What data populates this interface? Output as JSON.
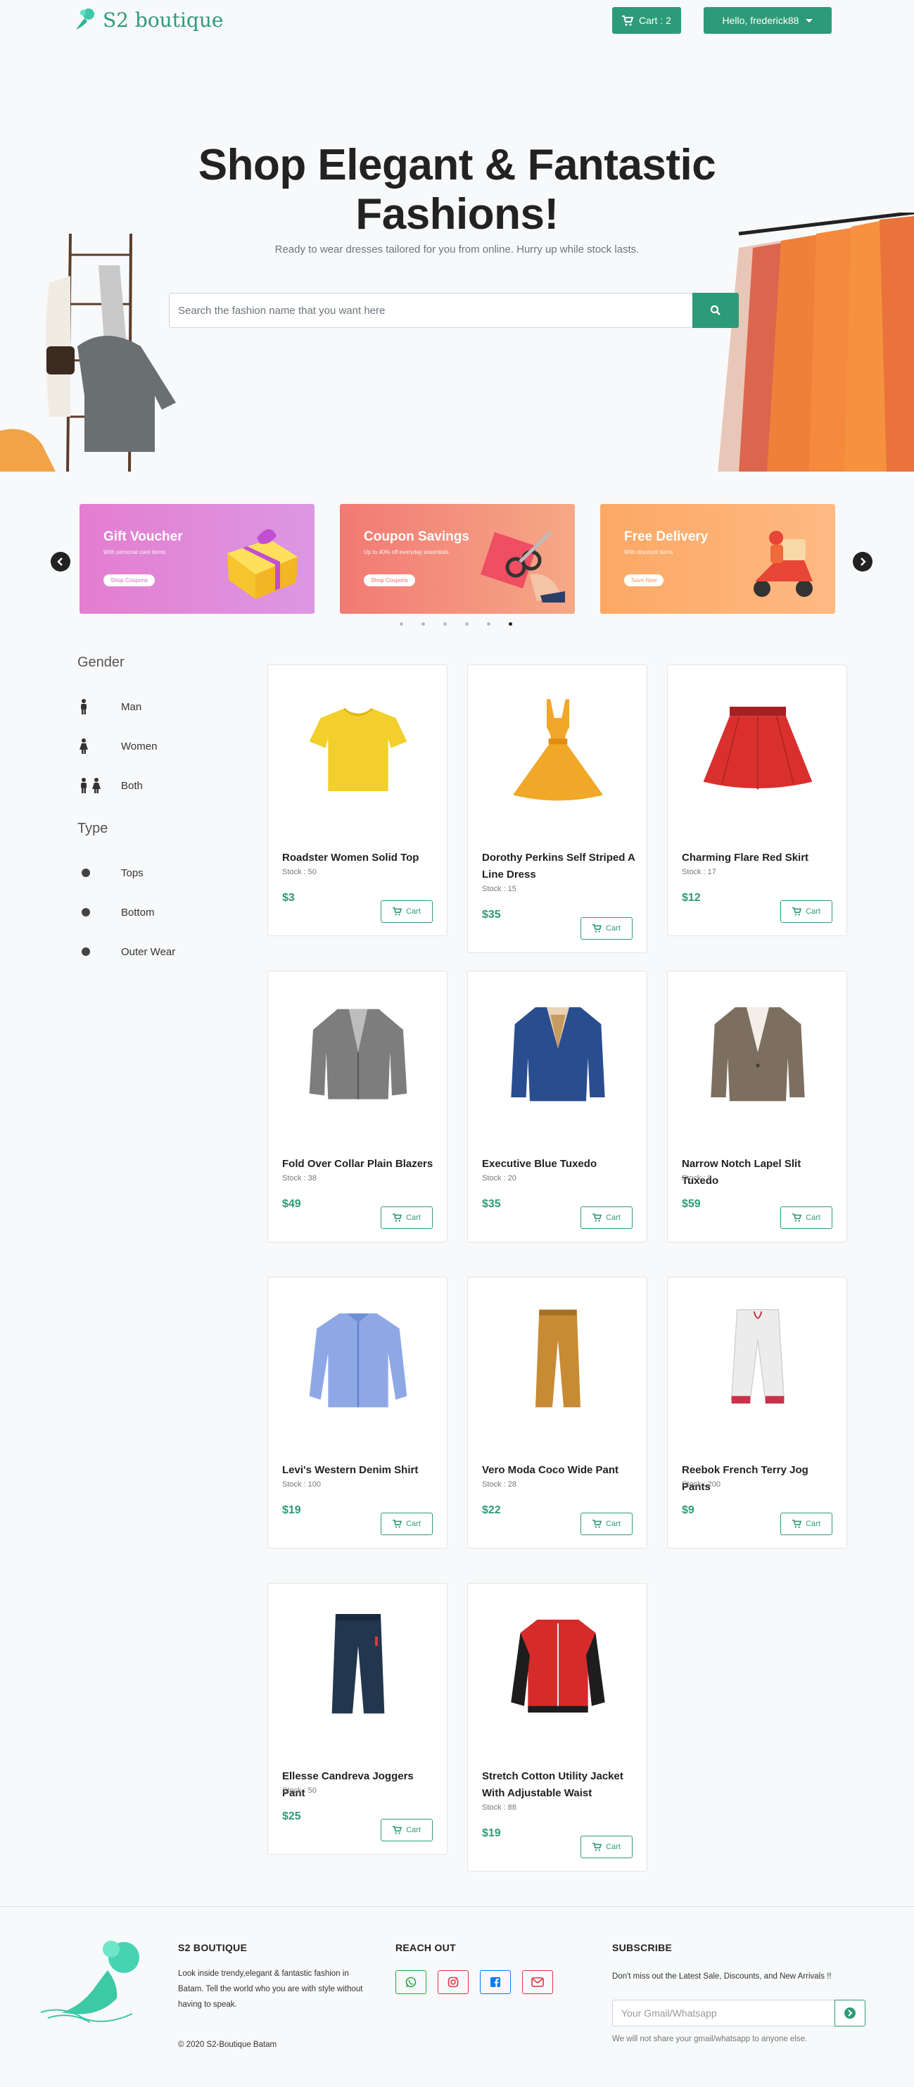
{
  "nav": {
    "brand": "S2 boutique",
    "cart_label": "Cart : 2",
    "user_label": "Hello, frederick88"
  },
  "hero": {
    "title_line1": "Shop Elegant & Fantastic",
    "title_line2": "Fashions!",
    "subtitle": "Ready to wear dresses tailored for you from online. Hurry up while stock lasts.",
    "search_placeholder": "Search the fashion name that you want here"
  },
  "promos": [
    {
      "title": "Gift Voucher",
      "desc": "With personal care items",
      "button": "Shop Coupons",
      "color_from": "#e77dd0",
      "color_to": "#d98ee8"
    },
    {
      "title": "Coupon Savings",
      "desc": "Up to 40% off everyday essentials",
      "button": "Shop Coupons",
      "color_from": "#f37a74",
      "color_to": "#f5a785"
    },
    {
      "title": "Free Delivery",
      "desc": "With discount items",
      "button": "Save Now",
      "color_from": "#fca866",
      "color_to": "#fdb57f"
    }
  ],
  "filters": {
    "gender_heading": "Gender",
    "gender": [
      "Man",
      "Women",
      "Both"
    ],
    "type_heading": "Type",
    "type": [
      "Tops",
      "Bottom",
      "Outer Wear"
    ]
  },
  "cart_button_label": "Cart",
  "products": [
    {
      "name": "Roadster Women Solid Top",
      "stock": "Stock : 50",
      "price": "$3",
      "icon": "yellow-top"
    },
    {
      "name": "Dorothy Perkins Self Striped A Line Dress",
      "stock": "Stock : 15",
      "price": "$35",
      "icon": "yellow-dress"
    },
    {
      "name": "Charming Flare Red Skirt",
      "stock": "Stock : 17",
      "price": "$12",
      "icon": "red-skirt"
    },
    {
      "name": "Fold Over Collar Plain Blazers",
      "stock": "Stock : 38",
      "price": "$49",
      "icon": "grey-blazer"
    },
    {
      "name": "Executive Blue Tuxedo",
      "stock": "Stock : 20",
      "price": "$35",
      "icon": "blue-tuxedo"
    },
    {
      "name": "Narrow Notch Lapel Slit Tuxedo",
      "stock": "Stock : 8",
      "price": "$59",
      "icon": "brown-tuxedo"
    },
    {
      "name": "Levi's Western Denim Shirt",
      "stock": "Stock : 100",
      "price": "$19",
      "icon": "denim-shirt"
    },
    {
      "name": "Vero Moda Coco Wide Pant",
      "stock": "Stock : 28",
      "price": "$22",
      "icon": "tan-pant"
    },
    {
      "name": "Reebok French Terry Jog Pants",
      "stock": "Stock : 200",
      "price": "$9",
      "icon": "white-jog-pant"
    },
    {
      "name": "Ellesse Candreva Joggers Pant",
      "stock": "Stock : 50",
      "price": "$25",
      "icon": "navy-jogger"
    },
    {
      "name": "Stretch Cotton Utility Jacket With Adjustable Waist",
      "stock": "Stock : 88",
      "price": "$19",
      "icon": "red-jacket"
    }
  ],
  "footer": {
    "about_heading": "S2 BOUTIQUE",
    "about_text": "Look inside trendy,elegant & fantastic fashion in Batam. Tell the world who you are with style without having to speak.",
    "copyright": "© 2020 S2-Boutique Batam",
    "reach_heading": "REACH OUT",
    "socials": [
      {
        "name": "whatsapp",
        "color": "#28a745"
      },
      {
        "name": "instagram",
        "color": "#dc3545"
      },
      {
        "name": "facebook",
        "color": "#007bff"
      },
      {
        "name": "email",
        "color": "#dc3545"
      }
    ],
    "subscribe_heading": "SUBSCRIBE",
    "subscribe_text": "Don't miss out the Latest Sale, Discounts, and New Arrivals !!",
    "subscribe_placeholder": "Your Gmail/Whatsapp",
    "subscribe_note": "We will not share your gmail/whatsapp to anyone else."
  },
  "colors": {
    "accent": "#2d9b78"
  }
}
